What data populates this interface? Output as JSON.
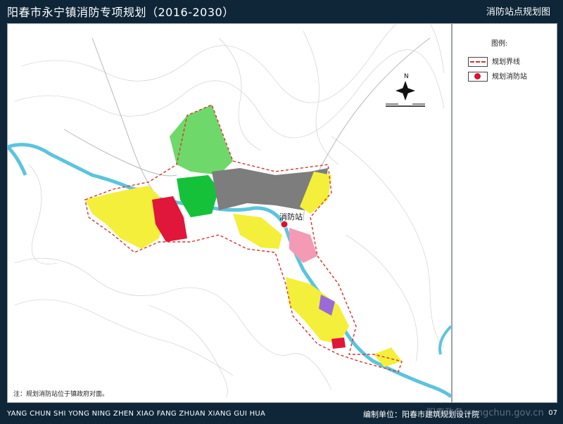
{
  "header": {
    "title": "阳春市永宁镇消防专项规划（2016-2030）",
    "subtitle": "消防站点规划图"
  },
  "legend": {
    "title": "图例:",
    "items": [
      {
        "label": "规划界线",
        "symbol": "dashed-red-line"
      },
      {
        "label": "规划消防站",
        "symbol": "red-dot"
      }
    ]
  },
  "map": {
    "station_label": "消防站",
    "note": "注：规划消防站位于镇政府对面。",
    "north_label": "N",
    "colors": {
      "river": "#5cc4dd",
      "residential": "#f4ef3a",
      "commercial": "#e0173a",
      "green": "#6fd86a",
      "industrial": "#7d7d7d",
      "park": "#16c13a",
      "public": "#f49ab5",
      "admin": "#9a6bd8",
      "background": "#ffffff"
    }
  },
  "footer": {
    "pinyin": "YANG CHUN SHI YONG NING ZHEN XIAO FANG ZHUAN XIANG GUI HUA",
    "org": "编制单位：阳春市建筑规划设计院",
    "page": "07",
    "watermark": "阳春政务 yangchun.gov.cn"
  }
}
